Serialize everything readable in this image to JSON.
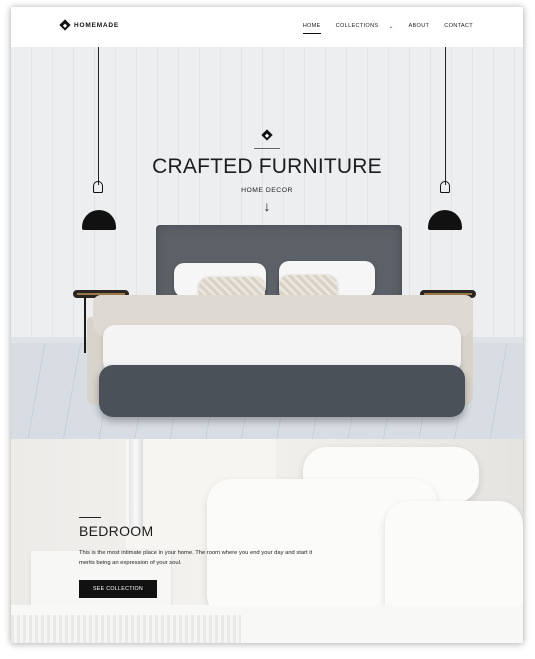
{
  "nav": {
    "logo_text": "HOMEMADE",
    "items": [
      {
        "label": "HOME",
        "active": true
      },
      {
        "label": "COLLECTIONS"
      },
      {
        "label": "ABOUT"
      },
      {
        "label": "CONTACT"
      }
    ],
    "dropdown_icon": "chevron-down-icon"
  },
  "hero": {
    "title": "CRAFTED FURNITURE",
    "subtitle": "HOME DECOR",
    "arrow": "↓",
    "mark_icon": "diamond-logo-icon"
  },
  "bedroom": {
    "title": "BEDROOM",
    "description": "This is the most intimate place in your home. The room where you end your day and start it merits being an expression of your soul.",
    "button_label": "SEE COLLECTION"
  }
}
